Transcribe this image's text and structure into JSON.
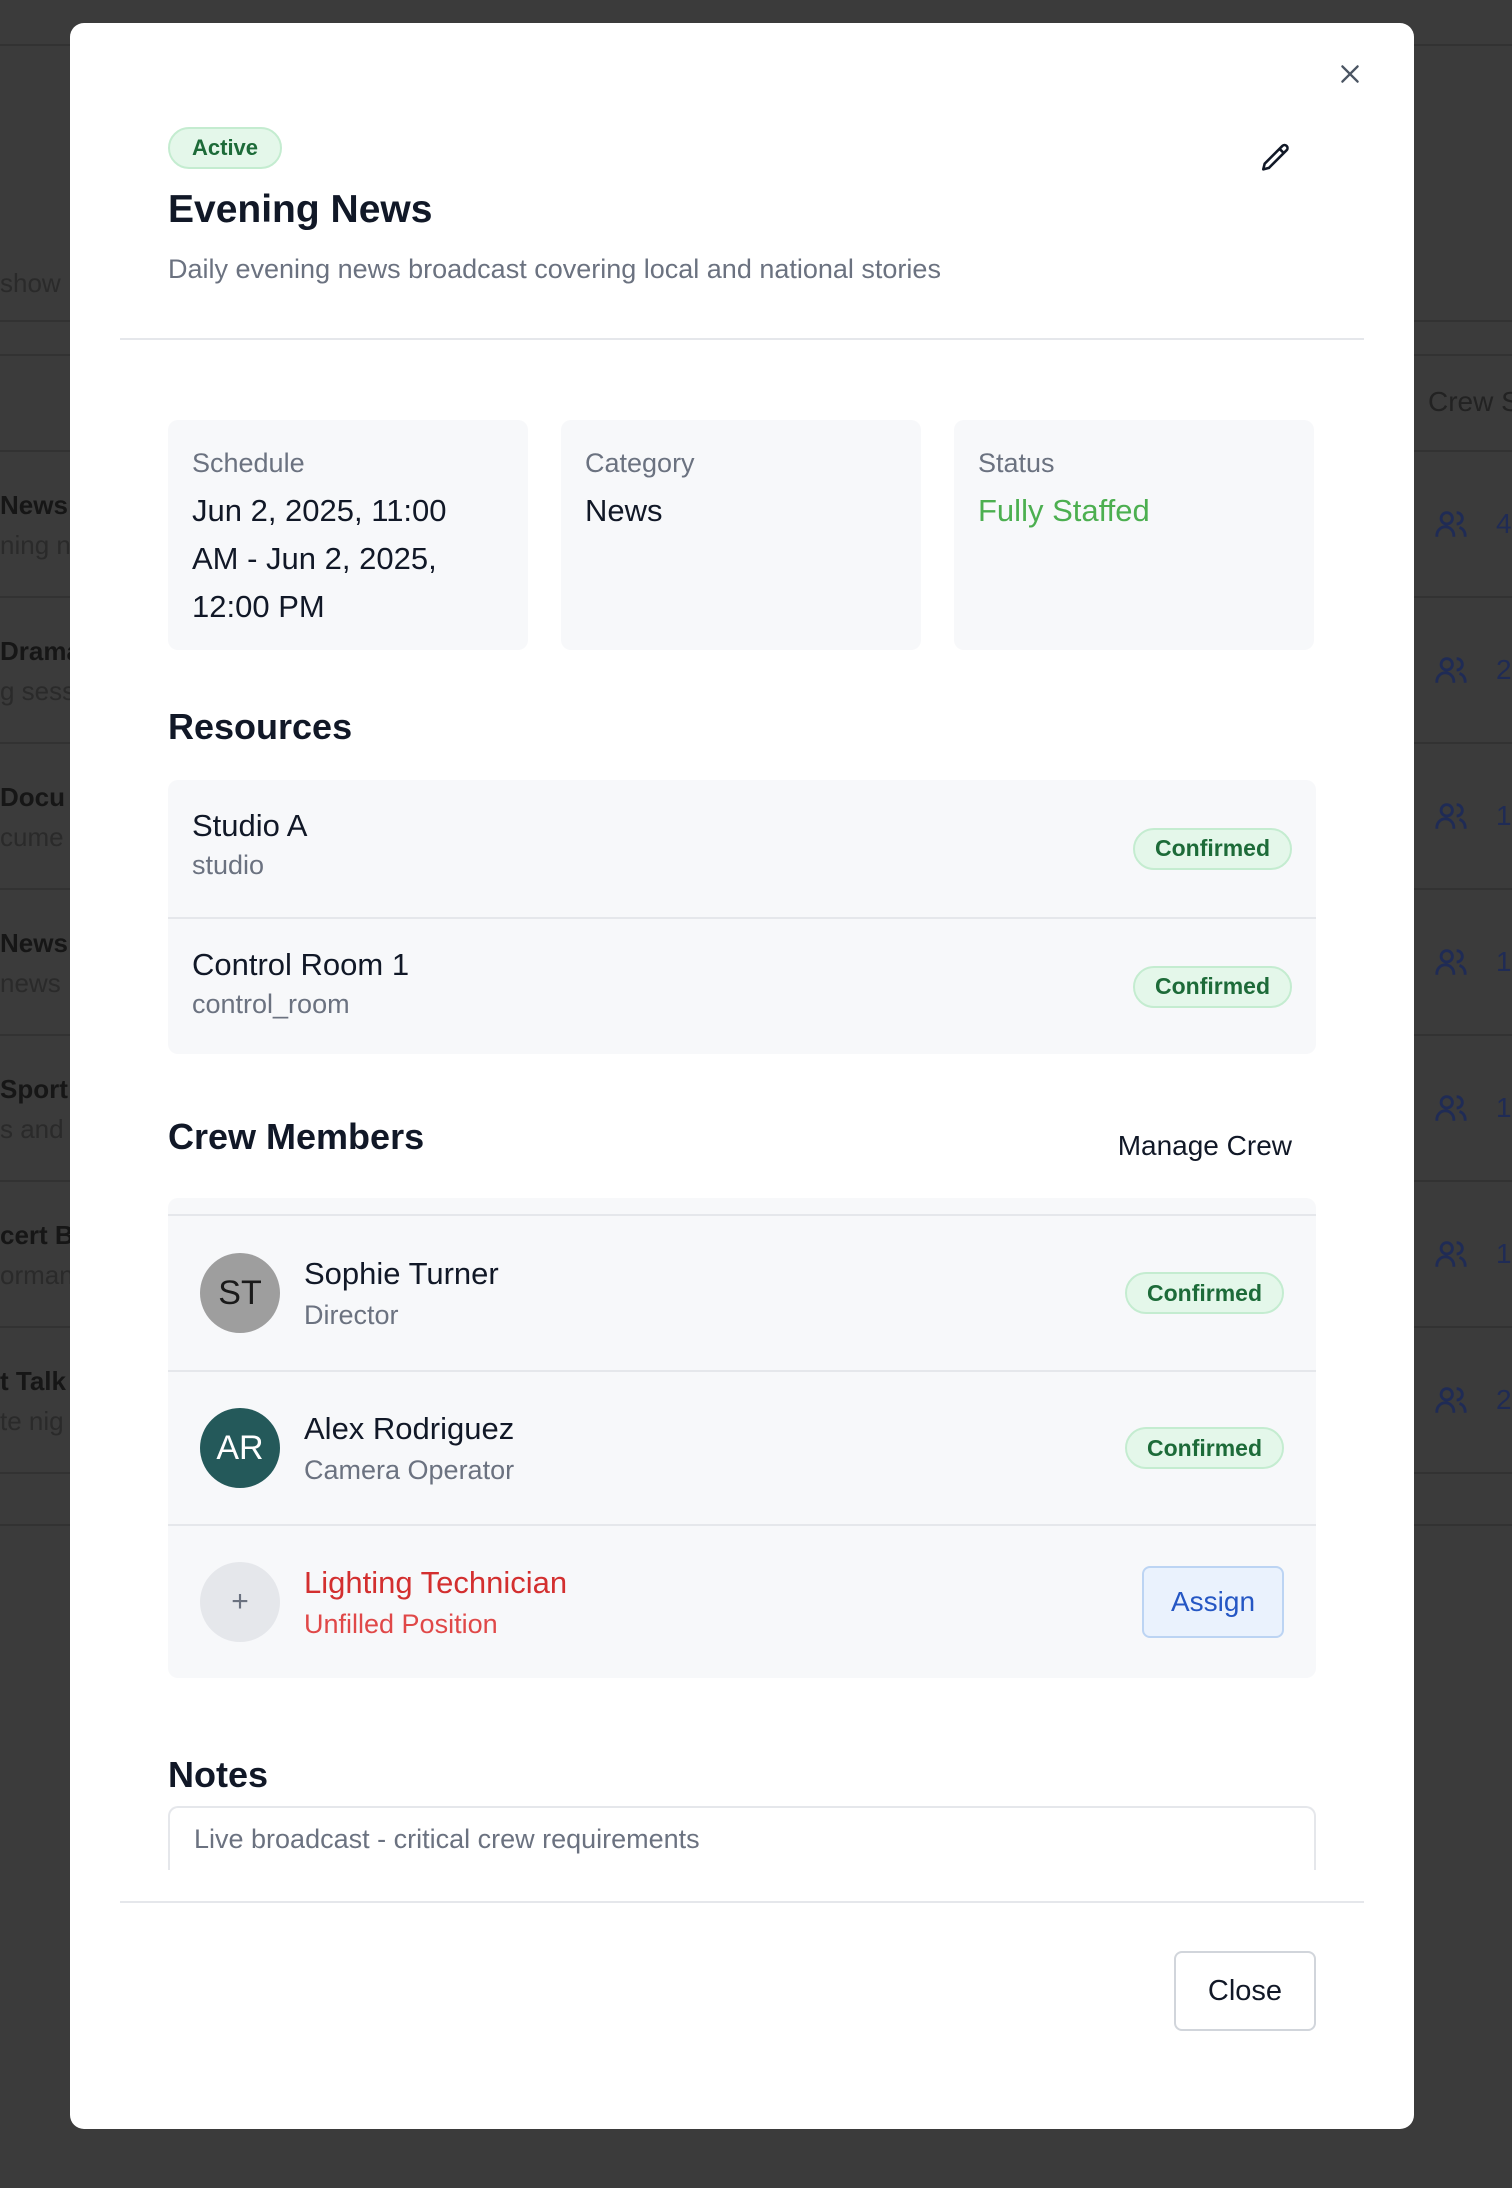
{
  "background": {
    "search_fragment": "show",
    "header_crew": "Crew S",
    "rows": [
      {
        "title": "News",
        "sub": "ning n",
        "count": "4"
      },
      {
        "title": "Drama",
        "sub": "g sess",
        "count": "2"
      },
      {
        "title": " Docu",
        "sub": "cume",
        "count": "1"
      },
      {
        "title": "News S",
        "sub": "news",
        "count": "1"
      },
      {
        "title": " Sport",
        "sub": "s and",
        "count": "1"
      },
      {
        "title": "cert B",
        "sub": "orman",
        "count": "1"
      },
      {
        "title": "t Talk",
        "sub": "te nig",
        "count": "2"
      }
    ]
  },
  "modal": {
    "status_badge": "Active",
    "title": "Evening News",
    "description": "Daily evening news broadcast covering local and national stories",
    "info": {
      "schedule_label": "Schedule",
      "schedule_lines": [
        "Jun 2, 2025, 11:00",
        "AM - Jun 2, 2025,",
        "12:00 PM"
      ],
      "category_label": "Category",
      "category_value": "News",
      "status_label": "Status",
      "status_value": "Fully Staffed",
      "status_color": "#4caf50"
    },
    "resources": {
      "title": "Resources",
      "items": [
        {
          "name": "Studio A",
          "type": "studio",
          "status": "Confirmed"
        },
        {
          "name": "Control Room 1",
          "type": "control_room",
          "status": "Confirmed"
        }
      ]
    },
    "crew": {
      "title": "Crew Members",
      "manage_label": "Manage Crew",
      "members": [
        {
          "initials": "ST",
          "name": "Sophie Turner",
          "role": "Director",
          "status": "Confirmed"
        },
        {
          "initials": "AR",
          "name": "Alex Rodriguez",
          "role": "Camera Operator",
          "status": "Confirmed"
        }
      ],
      "unfilled": {
        "icon": "+",
        "name": "Lighting Technician",
        "role": "Unfilled Position",
        "action": "Assign"
      }
    },
    "notes": {
      "title": "Notes",
      "text": "Live broadcast - critical crew requirements"
    },
    "close_label": "Close"
  }
}
